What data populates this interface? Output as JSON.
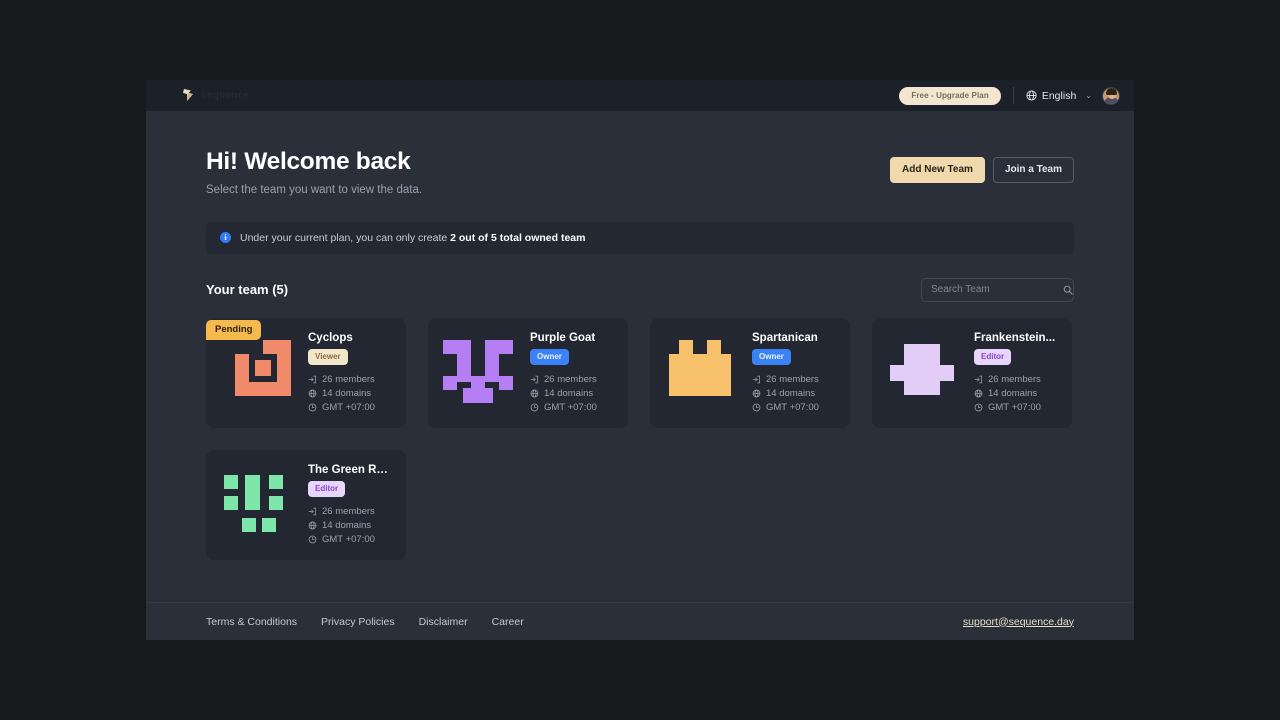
{
  "header": {
    "logo_name": "flag-logo-icon",
    "brand": "sequence",
    "plan_label": "Free - Upgrade Plan",
    "globe_icon": "globe-icon",
    "language": "English",
    "chevron": "⌄",
    "avatar_alt": "user-avatar"
  },
  "hero": {
    "title": "Hi! Welcome back",
    "subtitle": "Select the team you want to view the data.",
    "add_team_label": "Add New Team",
    "join_team_label": "Join a Team"
  },
  "notice": {
    "icon": "info-icon",
    "icon_glyph": "i",
    "text_before": "Under your current plan, you can only create ",
    "text_bold": "2 out of 5 total owned team"
  },
  "section": {
    "title": "Your team (5)",
    "search_placeholder": "Search Team",
    "search_value": "",
    "search_icon": "search-icon"
  },
  "meta_icons": {
    "members": "members-login-icon",
    "domains": "globe-icon",
    "timezone": "clock-icon"
  },
  "teams": [
    {
      "name": "Cyclops",
      "role": "Viewer",
      "role_class": "role-viewer",
      "status": "Pending",
      "members": "26 members",
      "domains": "14 domains",
      "timezone": "GMT +07:00",
      "avatar_color": "#f08a6a",
      "avatar_name": "cyclops-pixel-avatar"
    },
    {
      "name": "Purple Goat",
      "role": "Owner",
      "role_class": "role-owner",
      "status": "",
      "members": "26 members",
      "domains": "14 domains",
      "timezone": "GMT +07:00",
      "avatar_color": "#b57ef5",
      "avatar_name": "purple-goat-pixel-avatar"
    },
    {
      "name": "Spartanican",
      "role": "Owner",
      "role_class": "role-owner",
      "status": "",
      "members": "26 members",
      "domains": "14 domains",
      "timezone": "GMT +07:00",
      "avatar_color": "#f7c06a",
      "avatar_name": "spartanican-pixel-avatar"
    },
    {
      "name": "Frankenstein...",
      "role": "Editor",
      "role_class": "role-editor",
      "status": "",
      "members": "26 members",
      "domains": "14 domains",
      "timezone": "GMT +07:00",
      "avatar_color": "#e2cdf7",
      "avatar_name": "frankenstein-pixel-avatar"
    },
    {
      "name": "The Green Robo",
      "role": "Editor",
      "role_class": "role-editor",
      "status": "",
      "members": "26 members",
      "domains": "14 domains",
      "timezone": "GMT +07:00",
      "avatar_color": "#7fe6a9",
      "avatar_name": "green-robo-pixel-avatar"
    }
  ],
  "footer": {
    "links": [
      "Terms & Conditions",
      "Privacy Policies",
      "Disclaimer",
      "Career"
    ],
    "email": "support@sequence.day"
  }
}
